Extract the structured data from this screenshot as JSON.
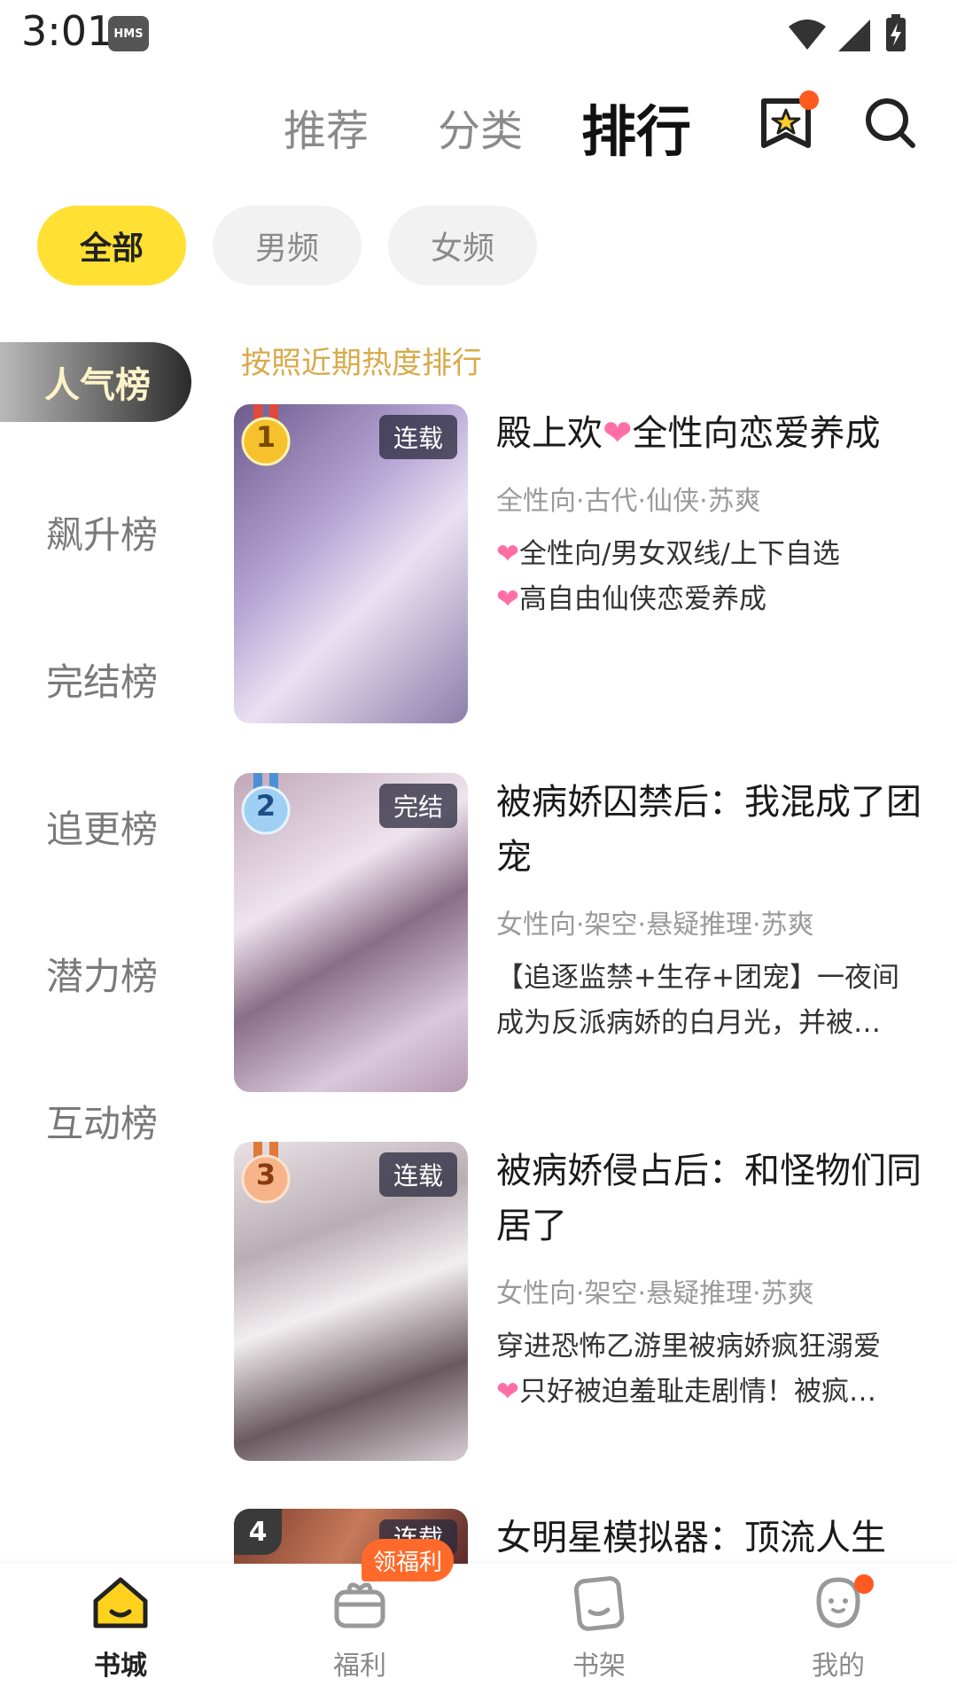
{
  "status_bar": {
    "time": "3:01",
    "hms": "HMS"
  },
  "top_nav": {
    "tabs": [
      "推荐",
      "分类",
      "排行"
    ],
    "active_tab": "排行"
  },
  "filters": [
    "全部",
    "男频",
    "女频"
  ],
  "active_filter": "全部",
  "categories": [
    "人气榜",
    "飙升榜",
    "完结榜",
    "追更榜",
    "潜力榜",
    "互动榜"
  ],
  "hint": "按照近期热度排行",
  "books": [
    {
      "rank": "1",
      "status": "连载",
      "title_part1": "殿上欢",
      "title_part2": "全性向恋爱养成",
      "tags": "全性向·古代·仙侠·苏爽",
      "desc_line1": "全性向/男女双线/上下自选",
      "desc_line2": "高自由仙侠恋爱养成"
    },
    {
      "rank": "2",
      "status": "完结",
      "title": "被病娇囚禁后：我混成了团宠",
      "tags": "女性向·架空·悬疑推理·苏爽",
      "desc_line1": "【追逐监禁+生存+团宠】一夜间",
      "desc_line2": "成为反派病娇的白月光，并被…"
    },
    {
      "rank": "3",
      "status": "连载",
      "title": "被病娇侵占后：和怪物们同居了",
      "tags": "女性向·架空·悬疑推理·苏爽",
      "desc_line1": "穿进恐怖乙游里被病娇疯狂溺爱",
      "desc_line2": "只好被迫羞耻走剧情！被疯…"
    },
    {
      "rank": "4",
      "status": "连载",
      "title": "女明星模拟器：顶流人生"
    }
  ],
  "bottom_nav": {
    "items": [
      "书城",
      "福利",
      "书架",
      "我的"
    ],
    "active": "书城",
    "welfare_badge": "领福利"
  },
  "colors": {
    "accent_yellow": "#ffe033",
    "hint_gold": "#d8aa4a",
    "badge_orange": "#ff6a2a",
    "heart_pink": "#ff6fa6"
  },
  "icons": [
    "hms-icon",
    "wifi-icon",
    "signal-icon",
    "battery-icon",
    "bookmark-star-icon",
    "search-icon",
    "medal-icon",
    "home-icon",
    "gift-icon",
    "bookshelf-icon",
    "profile-icon"
  ]
}
